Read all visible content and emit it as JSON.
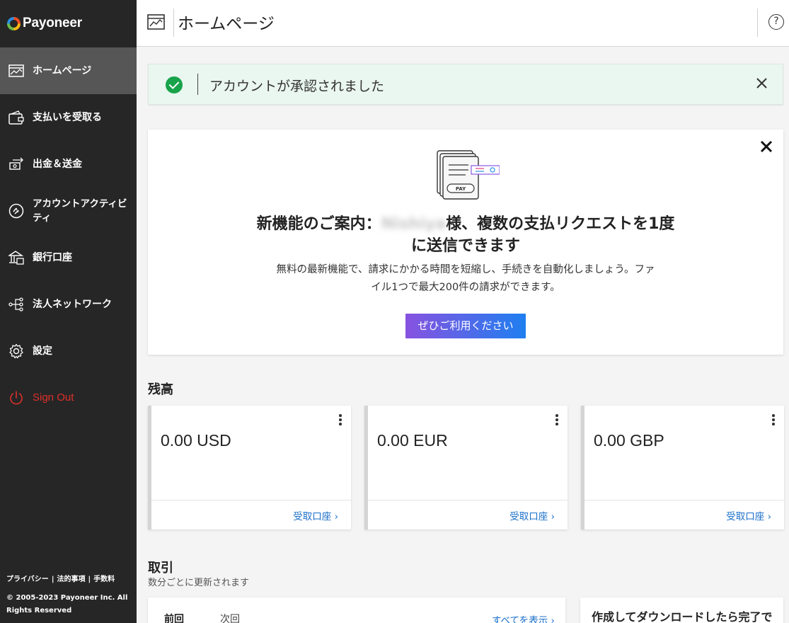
{
  "brand": {
    "name": "Payoneer"
  },
  "sidebar": {
    "items": [
      {
        "label": "ホームページ",
        "icon": "home-chart-icon",
        "active": true
      },
      {
        "label": "支払いを受取る",
        "icon": "wallet-icon"
      },
      {
        "label": "出金＆送金",
        "icon": "transfer-icon"
      },
      {
        "label": "アカウントアクティビ",
        "label2": "ティ",
        "icon": "activity-icon"
      },
      {
        "label": "銀行口座",
        "icon": "bank-icon"
      },
      {
        "label": "法人ネットワーク",
        "icon": "network-icon"
      },
      {
        "label": "設定",
        "icon": "gear-icon"
      },
      {
        "label": "Sign Out",
        "icon": "power-icon",
        "color": "#e0302a"
      }
    ],
    "footer": {
      "privacy": "プライバシー",
      "legal": "法的事項",
      "fees": "手数料",
      "separator": "|",
      "copyright_line1": "© 2005-2023 Payoneer Inc. All",
      "copyright_line2": "Rights Reserved"
    }
  },
  "header": {
    "title": "ホームページ",
    "help": "?"
  },
  "banner": {
    "text": "アカウントが承認されました",
    "status_color": "#17a34a"
  },
  "promo": {
    "illustration_label": "PAY",
    "title_prefix": "新機能のご案内：",
    "blurred_name": "Nishiya",
    "title_suffix": "様、複数の支払リクエストを1度",
    "title_line2": "に送信できます",
    "desc_line1": "無料の最新機能で、請求にかかる時間を短縮し、手続きを自動化しましょう。ファ",
    "desc_line2": "イル1つで最大200件の請求ができます。",
    "button": "ぜひご利用ください"
  },
  "balance": {
    "title": "残高",
    "link_label": "受取口座",
    "cards": [
      {
        "amount": "0.00 USD"
      },
      {
        "amount": "0.00 EUR"
      },
      {
        "amount": "0.00 GBP"
      }
    ]
  },
  "transactions": {
    "title": "取引",
    "subtitle": "数分ごとに更新されます",
    "tab_previous": "前回",
    "tab_next": "次回",
    "view_all": "すべてを表示",
    "download_text": "作成してダウンロードしたら完了で"
  },
  "colors": {
    "sidebar_bg": "#262626",
    "active_item_bg": "#565656",
    "link": "#1a6fc9",
    "signout": "#e0302a"
  }
}
